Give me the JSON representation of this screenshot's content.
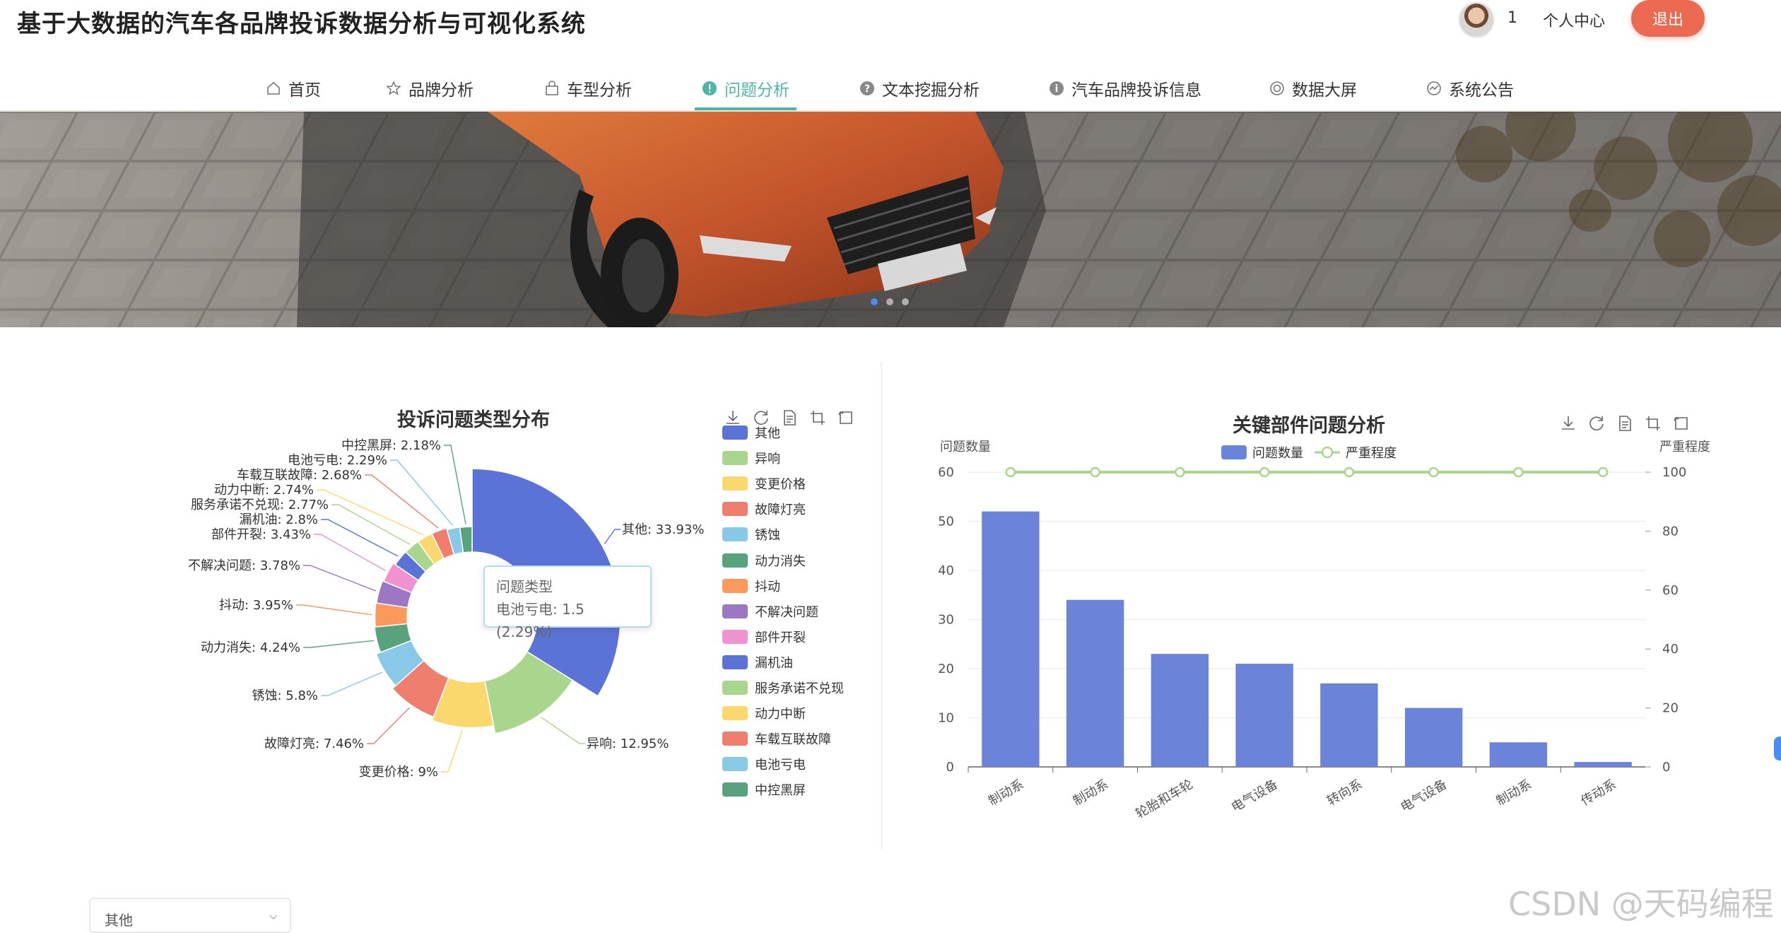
{
  "app": {
    "title": "基于大数据的汽车各品牌投诉数据分析与可视化系统"
  },
  "user": {
    "id": "1",
    "center_label": "个人中心",
    "logout_label": "退出"
  },
  "nav": {
    "items": [
      {
        "label": "首页",
        "icon": "home-icon"
      },
      {
        "label": "品牌分析",
        "icon": "star-icon"
      },
      {
        "label": "车型分析",
        "icon": "bag-icon"
      },
      {
        "label": "问题分析",
        "icon": "warning-icon",
        "active": true
      },
      {
        "label": "文本挖掘分析",
        "icon": "question-icon"
      },
      {
        "label": "汽车品牌投诉信息",
        "icon": "info-icon"
      },
      {
        "label": "数据大屏",
        "icon": "target-icon"
      },
      {
        "label": "系统公告",
        "icon": "chart-circle-icon"
      }
    ]
  },
  "banner": {
    "slides": 3,
    "active": 1
  },
  "pie_tooltip": {
    "title": "问题类型",
    "line": "电池亏电: 1.5 (2.29%)"
  },
  "filter": {
    "selected": "其他"
  },
  "watermark": "CSDN @天码编程",
  "chart_data": [
    {
      "type": "pie",
      "variant": "rose",
      "title": "投诉问题类型分布",
      "legend_position": "right",
      "slices": [
        {
          "name": "其他",
          "percent": 33.93,
          "color": "#5b73d6"
        },
        {
          "name": "异响",
          "percent": 12.95,
          "color": "#a8d68c"
        },
        {
          "name": "变更价格",
          "percent": 9,
          "color": "#fbd86e"
        },
        {
          "name": "故障灯亮",
          "percent": 7.46,
          "color": "#f07e6e"
        },
        {
          "name": "锈蚀",
          "percent": 5.8,
          "color": "#88c9e8"
        },
        {
          "name": "动力消失",
          "percent": 4.24,
          "color": "#58a37e"
        },
        {
          "name": "抖动",
          "percent": 3.95,
          "color": "#f99a5c"
        },
        {
          "name": "不解决问题",
          "percent": 3.78,
          "color": "#9c78c4"
        },
        {
          "name": "部件开裂",
          "percent": 3.43,
          "color": "#ef92cf"
        },
        {
          "name": "漏机油",
          "percent": 2.8,
          "color": "#5b73d6"
        },
        {
          "name": "服务承诺不兑现",
          "percent": 2.77,
          "color": "#a8d68c"
        },
        {
          "name": "动力中断",
          "percent": 2.74,
          "color": "#fbd86e"
        },
        {
          "name": "车载互联故障",
          "percent": 2.68,
          "color": "#f07e6e"
        },
        {
          "name": "电池亏电",
          "percent": 2.29,
          "color": "#88c9e8"
        },
        {
          "name": "中控黑屏",
          "percent": 2.18,
          "color": "#58a37e"
        }
      ]
    },
    {
      "type": "bar",
      "title": "关键部件问题分析",
      "categories": [
        "制动系",
        "制动系",
        "轮胎和车轮",
        "电气设备",
        "转向系",
        "电气设备",
        "制动系",
        "传动系"
      ],
      "series": [
        {
          "name": "问题数量",
          "type": "bar",
          "color": "#6b84d9",
          "values": [
            52,
            34,
            23,
            21,
            17,
            12,
            5,
            1
          ]
        },
        {
          "name": "严重程度",
          "type": "line",
          "color": "#a8d68c",
          "axis": "right",
          "values": [
            100,
            100,
            100,
            100,
            100,
            100,
            100,
            100
          ]
        }
      ],
      "ylabel_left": "问题数量",
      "ylabel_right": "严重程度",
      "ylim_left": [
        0,
        60
      ],
      "ylim_right": [
        0,
        100
      ],
      "yticks_left": [
        0,
        10,
        20,
        30,
        40,
        50,
        60
      ],
      "yticks_right": [
        0,
        20,
        40,
        60,
        80,
        100
      ],
      "grid": true,
      "legend_position": "top-center"
    }
  ]
}
